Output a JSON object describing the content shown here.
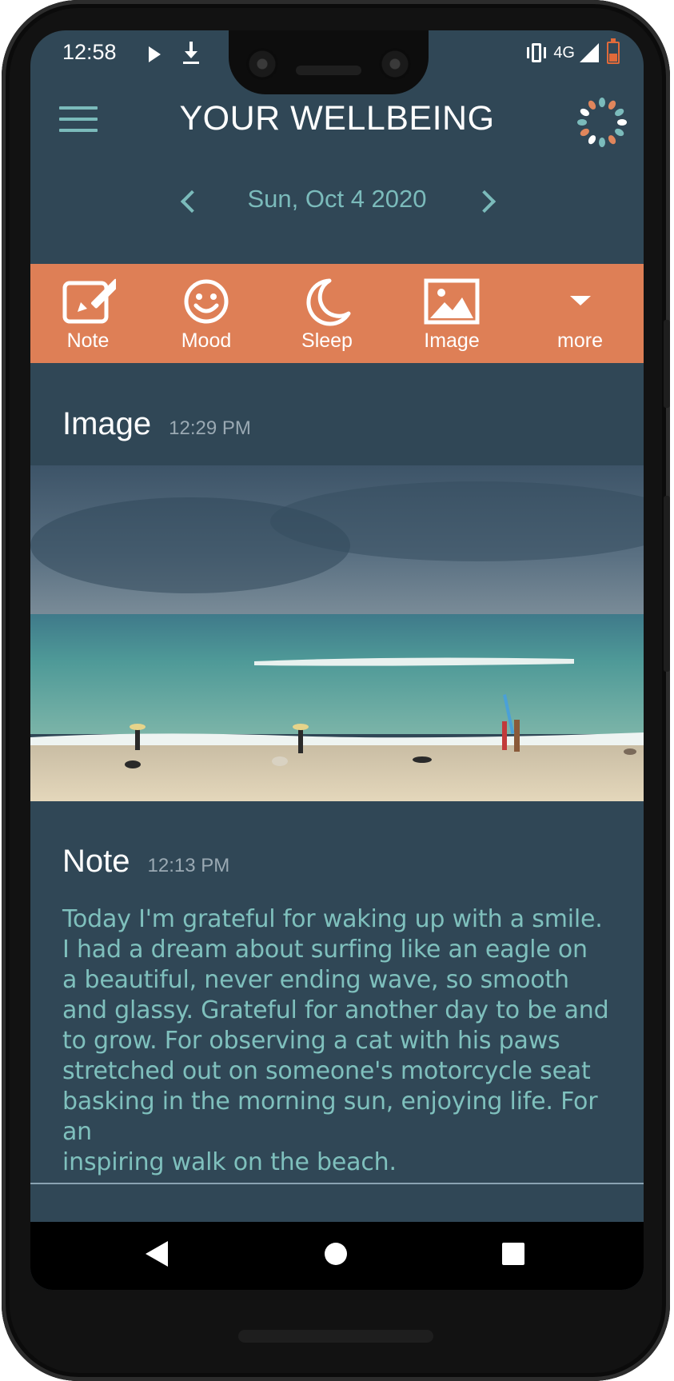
{
  "status_bar": {
    "time": "12:58",
    "network": "4G",
    "icons": [
      "play-icon",
      "download-icon",
      "vibrate-icon",
      "signal-icon",
      "battery-icon"
    ]
  },
  "header": {
    "title": "YOUR WELLBEING",
    "menu_icon": "hamburger-menu-icon",
    "logo_icon": "dotted-ring-logo-icon"
  },
  "date_nav": {
    "date": "Sun, Oct 4 2020",
    "prev_icon": "chevron-left-icon",
    "next_icon": "chevron-right-icon"
  },
  "toolbar": {
    "items": [
      {
        "label": "Note",
        "icon": "edit-note-icon"
      },
      {
        "label": "Mood",
        "icon": "smiley-face-icon"
      },
      {
        "label": "Sleep",
        "icon": "crescent-moon-icon"
      },
      {
        "label": "Image",
        "icon": "picture-icon"
      },
      {
        "label": "more",
        "icon": "caret-down-icon"
      }
    ]
  },
  "entries": {
    "image": {
      "title": "Image",
      "time": "12:29 PM"
    },
    "note": {
      "title": "Note",
      "time": "12:13 PM",
      "lines": [
        "Today I'm grateful for waking up with a smile.",
        "I had a dream about surfing like an eagle on",
        "a beautiful, never ending wave, so smooth",
        "and glassy. Grateful for another day to be and",
        "to grow. For observing a cat with his paws",
        "stretched out on someone's motorcycle seat",
        "basking in the morning sun, enjoying life. For an",
        "inspiring walk on the beach."
      ]
    }
  },
  "colors": {
    "background": "#304756",
    "accent": "#de7f56",
    "teal": "#7bbbbb",
    "note_text": "#7fc0bd"
  },
  "nav_bar": {
    "icons": [
      "back-icon",
      "home-icon",
      "recents-icon"
    ]
  }
}
